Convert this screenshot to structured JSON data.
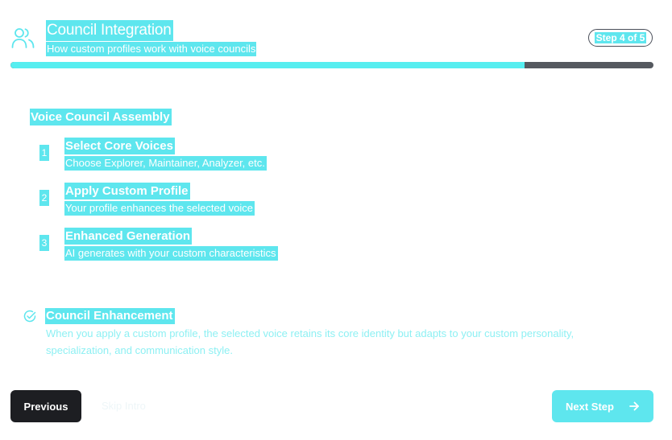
{
  "header": {
    "icon": "users-icon",
    "title": "Council Integration",
    "subtitle": "How custom profiles work with voice councils",
    "step_badge": "Step 4 of 5"
  },
  "progress": {
    "fraction": 0.8
  },
  "assembly": {
    "title": "Voice Council Assembly",
    "steps": [
      {
        "number": "1",
        "title": "Select Core Voices",
        "description": "Choose Explorer, Maintainer, Analyzer, etc."
      },
      {
        "number": "2",
        "title": "Apply Custom Profile",
        "description": "Your profile enhances the selected voice"
      },
      {
        "number": "3",
        "title": "Enhanced Generation",
        "description": "AI generates with your custom characteristics"
      }
    ]
  },
  "enhancement": {
    "icon": "check-circle-icon",
    "title": "Council Enhancement",
    "body": "When you apply a custom profile, the selected voice retains its core identity but adapts to your custom personality, specialization, and communication style."
  },
  "footer": {
    "previous_label": "Previous",
    "skip_label": "Skip Intro",
    "next_label": "Next Step",
    "next_icon": "arrow-right-icon"
  },
  "colors": {
    "accent": "#5ee6ee",
    "progress_fill": "#56eef0",
    "progress_track": "#55595f",
    "previous_button": "#1d1e22"
  }
}
